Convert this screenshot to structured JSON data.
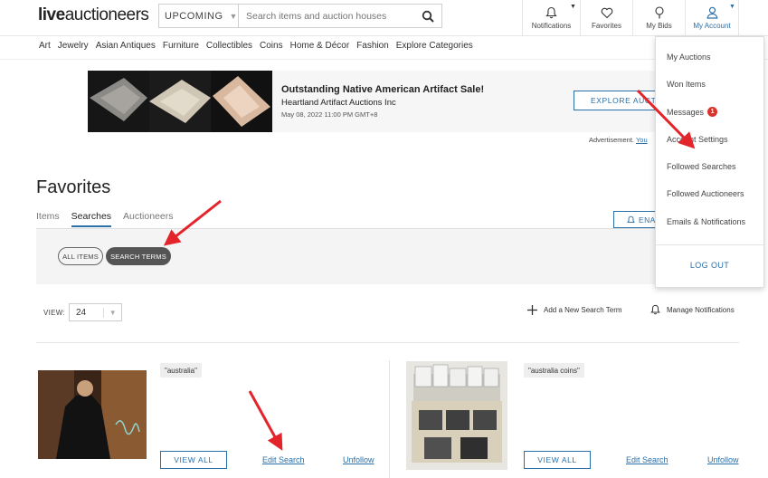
{
  "header": {
    "logo_bold": "live",
    "logo_rest": "auctioneers",
    "search_scope": "UPCOMING",
    "search_placeholder": "Search items and auction houses",
    "notifications": "Notifications",
    "favorites": "Favorites",
    "my_bids": "My Bids",
    "my_account": "My Account"
  },
  "categories": [
    "Art",
    "Jewelry",
    "Asian Antiques",
    "Furniture",
    "Collectibles",
    "Coins",
    "Home & Décor",
    "Fashion",
    "Explore Categories"
  ],
  "ad": {
    "title": "Outstanding Native American Artifact Sale!",
    "house": "Heartland Artifact Auctions Inc",
    "date": "May 08, 2022 11:00 PM GMT+8",
    "button": "EXPLORE AUCTION",
    "note_prefix": "Advertisement.",
    "note_link": "You"
  },
  "favorites": {
    "title": "Favorites",
    "tabs": [
      "Items",
      "Searches",
      "Auctioneers"
    ],
    "active_tab": "Searches",
    "email_button": "ENA",
    "pill_all": "ALL ITEMS",
    "pill_search": "SEARCH TERMS",
    "view_label": "VIEW:",
    "view_value": "24",
    "add_term": "Add a New Search Term",
    "manage_notifications": "Manage Notifications"
  },
  "cards": [
    {
      "term": "\"australia\"",
      "view_all": "VIEW ALL",
      "edit": "Edit Search",
      "unfollow": "Unfollow"
    },
    {
      "term": "\"australia coins\"",
      "view_all": "VIEW ALL",
      "edit": "Edit Search",
      "unfollow": "Unfollow"
    }
  ],
  "account_menu": {
    "items": [
      "My Auctions",
      "Won Items",
      "Messages",
      "Account Settings",
      "Followed Searches",
      "Followed Auctioneers",
      "Emails & Notifications"
    ],
    "messages_badge": "1",
    "logout": "LOG OUT"
  },
  "colors": {
    "accent": "#2a6fa8",
    "badge": "#d9342b",
    "arrow": "#e3242b"
  }
}
